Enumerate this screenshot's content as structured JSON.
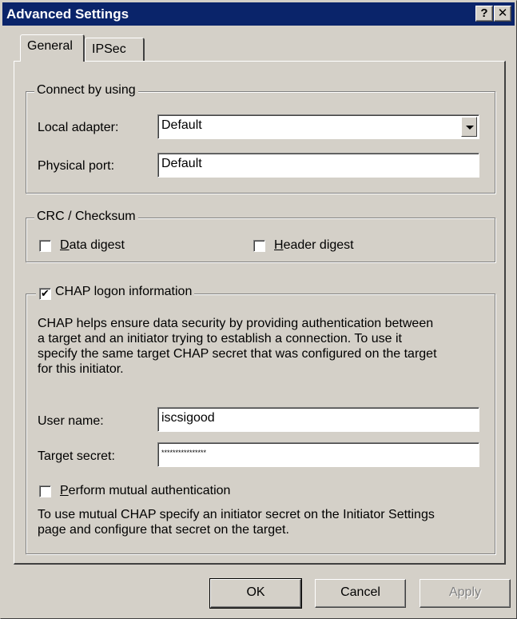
{
  "window": {
    "title": "Advanced Settings",
    "help_label": "?",
    "close_label": "✕"
  },
  "tabs": [
    {
      "label": "General",
      "active": true
    },
    {
      "label": "IPSec",
      "active": false
    }
  ],
  "connect": {
    "legend": "Connect by using",
    "local_adapter_label": "Local adapter:",
    "local_adapter_value": "Default",
    "physical_port_label": "Physical port:",
    "physical_port_value": "Default"
  },
  "crc": {
    "legend": "CRC / Checksum",
    "data_digest_label": "Data digest",
    "data_digest_checked": false,
    "header_digest_label": "Header digest",
    "header_digest_checked": false
  },
  "chap": {
    "legend": "CHAP logon information",
    "checked": true,
    "check_mark": "✔",
    "description_lines": [
      "CHAP helps ensure data security by providing authentication between",
      "a target and an initiator trying to establish a connection. To use it",
      "specify the same target CHAP secret that was configured on the target",
      "for this initiator."
    ],
    "user_name_label": "User name:",
    "user_name_value": "iscsigood",
    "target_secret_label": "Target secret:",
    "target_secret_value": "****************",
    "mutual_label": "Perform mutual authentication",
    "mutual_checked": false,
    "mutual_description_lines": [
      "To use mutual CHAP specify an initiator secret on the Initiator Settings",
      "page and configure that secret on the target."
    ]
  },
  "buttons": {
    "ok": "OK",
    "cancel": "Cancel",
    "apply": "Apply"
  }
}
